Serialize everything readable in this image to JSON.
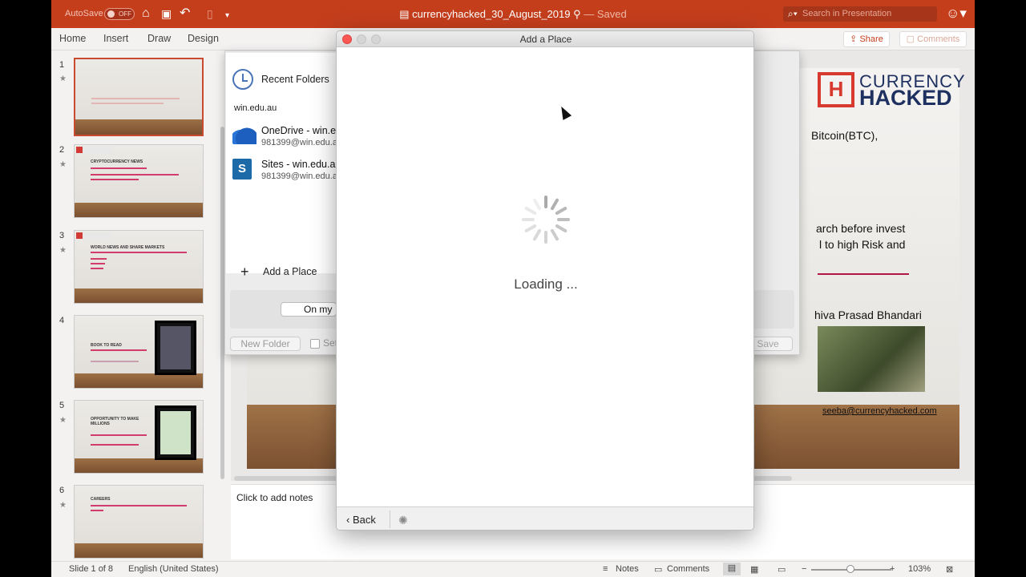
{
  "titlebar": {
    "autosave_label": "AutoSave",
    "autosave_state": "OFF",
    "doc_name": "currencyhacked_30_August_2019",
    "saved_status": "— Saved",
    "search_placeholder": "Search in Presentation",
    "accent": "#c43e1c"
  },
  "ribbon": {
    "tabs": [
      "Home",
      "Insert",
      "Draw",
      "Design"
    ],
    "share_label": "Share",
    "comments_label": "Comments"
  },
  "thumbnails": [
    {
      "number": "1",
      "title": ""
    },
    {
      "number": "2",
      "title": "CRYPTOCURRENCY NEWS"
    },
    {
      "number": "3",
      "title": "WORLD NEWS AND SHARE MARKETS"
    },
    {
      "number": "4",
      "title": "BOOK TO READ"
    },
    {
      "number": "5",
      "title": "OPPORTUNITY TO MAKE MILLIONS"
    },
    {
      "number": "6",
      "title": "CAREERS"
    }
  ],
  "slide": {
    "brand_top": "CURRENCY",
    "brand_bottom": "HACKED",
    "line1": "Bitcoin(BTC),",
    "line2": "arch before invest",
    "line3": "l to high Risk and",
    "author": "hiva Prasad Bhandari",
    "email": "seeba@currencyhacked.com"
  },
  "notes_placeholder": "Click to add notes",
  "save_dialog": {
    "recent_folders": "Recent Folders",
    "domain": "win.edu.au",
    "places": [
      {
        "name": "OneDrive - win.e",
        "account": "981399@win.edu.a"
      },
      {
        "name": "Sites - win.edu.a",
        "account": "981399@win.edu.a"
      }
    ],
    "add_place": "Add a Place",
    "on_my": "On my",
    "new_folder": "New Folder",
    "set_label": "Set",
    "save_label": "Save"
  },
  "add_place_dialog": {
    "title": "Add a Place",
    "loading_text": "Loading ...",
    "back_label": "Back"
  },
  "statusbar": {
    "slide_info": "Slide 1 of 8",
    "language": "English (United States)",
    "notes_label": "Notes",
    "comments_label": "Comments",
    "zoom": "103%"
  }
}
